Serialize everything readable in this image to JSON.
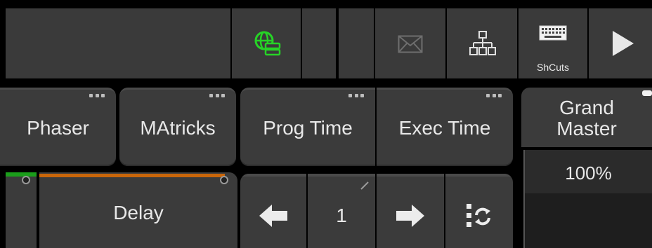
{
  "toolbar": {
    "shortcuts_label": "ShCuts",
    "icons": [
      "network-status-icon",
      "mail-icon",
      "network-tree-icon",
      "keyboard-icon",
      "play-icon"
    ],
    "network_icon_color": "#26d326"
  },
  "buttons": {
    "phaser": "Phaser",
    "matricks": "MAtricks",
    "prog_time": "Prog Time",
    "exec_time": "Exec Time"
  },
  "grand_master": {
    "line1": "Grand",
    "line2": "Master",
    "value": "100%"
  },
  "delay": {
    "label": "Delay",
    "bar_color": "#c9660a",
    "left_bar_color": "#1b9e1b"
  },
  "nav": {
    "page_number": "1"
  }
}
